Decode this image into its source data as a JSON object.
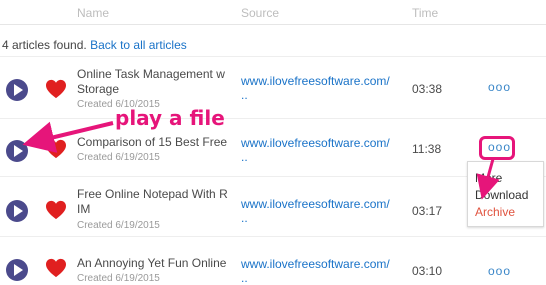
{
  "header": {
    "name_col": "Name",
    "source_col": "Source",
    "time_col": "Time"
  },
  "summary": {
    "count_text": "4 articles found.",
    "back_link": "Back to all articles"
  },
  "articles": [
    {
      "title_line1": "Online Task Management w",
      "title_line2": "Storage",
      "created": "Created 6/10/2015",
      "source_line1": "www.ilovefreesoftware.com/",
      "source_line2": "..",
      "time": "03:38",
      "more": "ooo"
    },
    {
      "title_line1": "Comparison of 15 Best Free",
      "title_line2": "",
      "created": "Created 6/19/2015",
      "source_line1": "www.ilovefreesoftware.com/",
      "source_line2": "..",
      "time": "11:38",
      "more": "ooo"
    },
    {
      "title_line1": "Free Online Notepad With R",
      "title_line2": "IM",
      "created": "Created 6/19/2015",
      "source_line1": "www.ilovefreesoftware.com/",
      "source_line2": "..",
      "time": "03:17",
      "more": ""
    },
    {
      "title_line1": "An Annoying Yet Fun Online",
      "title_line2": "",
      "created": "Created 6/19/2015",
      "source_line1": "www.ilovefreesoftware.com/",
      "source_line2": "..",
      "time": "03:10",
      "more": "ooo"
    }
  ],
  "context_menu": {
    "items": [
      "More",
      "Download",
      "Archive"
    ]
  },
  "annotation": {
    "callout": "play a file",
    "color": "#e6157a"
  },
  "colors": {
    "play_button": "#4b4a8c",
    "heart": "#e02020",
    "link": "#1a73c8",
    "archive": "#e0533f"
  },
  "icons": {
    "play": "play-circle-icon",
    "favorite": "heart-icon",
    "more": "more-dots-icon"
  }
}
